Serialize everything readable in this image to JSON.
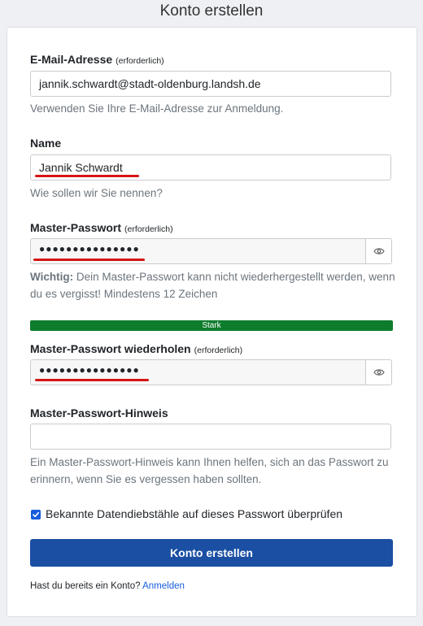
{
  "page_title": "Konto erstellen",
  "email": {
    "label": "E-Mail-Adresse",
    "required": "(erforderlich)",
    "value": "jannik.schwardt@stadt-oldenburg.landsh.de",
    "hint": "Verwenden Sie Ihre E-Mail-Adresse zur Anmeldung."
  },
  "name": {
    "label": "Name",
    "value": "Jannik Schwardt",
    "hint": "Wie sollen wir Sie nennen?"
  },
  "master_password": {
    "label": "Master-Passwort",
    "required": "(erforderlich)",
    "value": "●●●●●●●●●●●●●●●",
    "hint_bold": "Wichtig:",
    "hint": "Dein Master-Passwort kann nicht wiederhergestellt werden, wenn du es vergisst! Mindestens 12 Zeichen",
    "strength_label": "Stark",
    "strength_color": "#0e7c2d"
  },
  "master_password_repeat": {
    "label": "Master-Passwort wiederholen",
    "required": "(erforderlich)",
    "value": "●●●●●●●●●●●●●●●"
  },
  "password_hint": {
    "label": "Master-Passwort-Hinweis",
    "value": "",
    "hint": "Ein Master-Passwort-Hinweis kann Ihnen helfen, sich an das Passwort zu erinnern, wenn Sie es vergessen haben sollten."
  },
  "breach_check": {
    "label": "Bekannte Datendiebstähle auf dieses Passwort überprüfen",
    "checked": true
  },
  "submit_label": "Konto erstellen",
  "footer": {
    "text": "Hast du bereits ein Konto?",
    "link": "Anmelden"
  },
  "colors": {
    "primary": "#1a4fa3",
    "link": "#175ddc",
    "annotation_underline": "#d41515"
  },
  "icons": [
    "eye-icon",
    "checkmark-icon"
  ]
}
